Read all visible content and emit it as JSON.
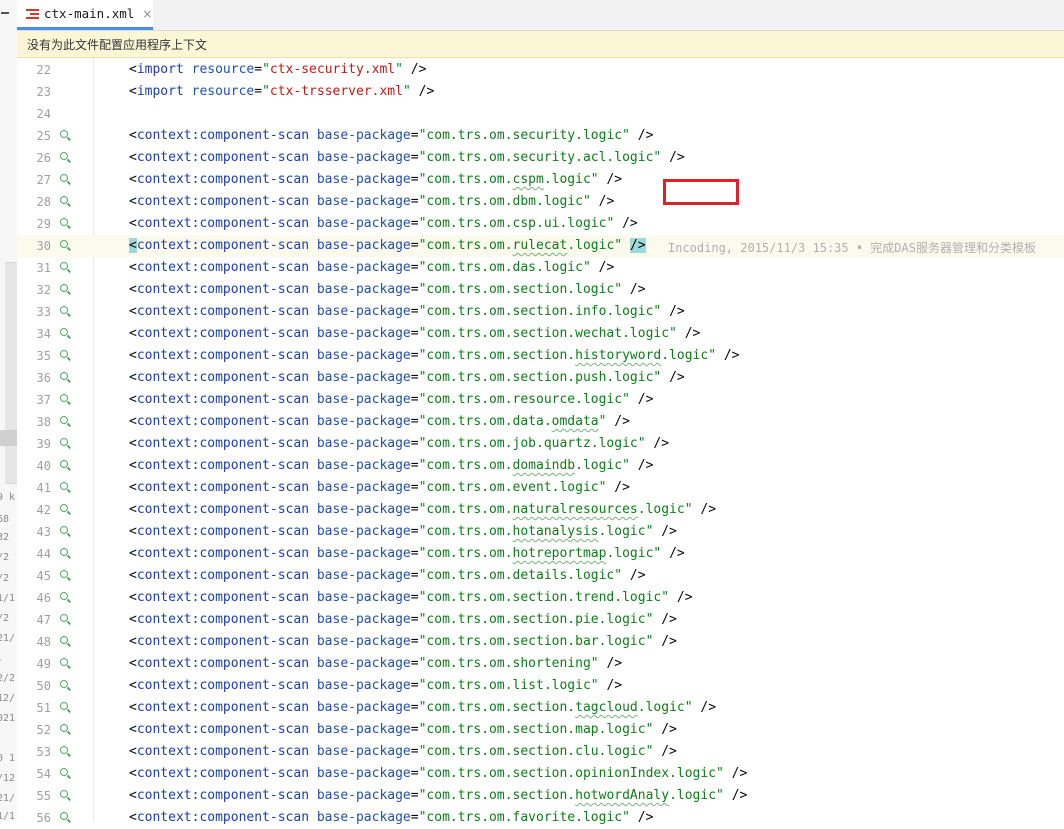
{
  "left_panel": {
    "fragments": [
      "9 k",
      "68",
      "32",
      "/2",
      "/2",
      "1/1",
      "/2",
      "21/",
      "-",
      "2/2",
      "12/",
      "021",
      "0 1",
      "/12",
      "21/",
      "1/1"
    ]
  },
  "tab": {
    "label": "ctx-main.xml",
    "close": "×"
  },
  "banner": {
    "text": "没有为此文件配置应用程序上下文"
  },
  "editor": {
    "current_line": 30,
    "blame": "Incoding, 2015/11/3 15:35 • 完成DAS服务器管理和分类模板",
    "lines": [
      {
        "num": "22",
        "kind": "import",
        "tag": "import",
        "attr": "resource",
        "value": "ctx-security.xml"
      },
      {
        "num": "23",
        "kind": "import",
        "tag": "import",
        "attr": "resource",
        "value": "ctx-trsserver.xml"
      },
      {
        "num": "24",
        "kind": "blank"
      },
      {
        "num": "25",
        "kind": "scan",
        "pre": "com.trs.om.security",
        "ul": "",
        "post": ".logic"
      },
      {
        "num": "26",
        "kind": "scan",
        "pre": "com.trs.om.security.acl.logic",
        "ul": "",
        "post": ""
      },
      {
        "num": "27",
        "kind": "scan",
        "pre": "com.trs.om.",
        "ul": "cspm",
        "post": ".logic"
      },
      {
        "num": "28",
        "kind": "scan",
        "pre": "com.trs.om.dbm.logic",
        "ul": "",
        "post": ""
      },
      {
        "num": "29",
        "kind": "scan",
        "pre": "com.trs.om.csp.ui.logic",
        "ul": "",
        "post": ""
      },
      {
        "num": "30",
        "kind": "scan",
        "pre": "com.trs.om.",
        "ul": "rulecat",
        "post": ".logic"
      },
      {
        "num": "31",
        "kind": "scan",
        "pre": "com.trs.om.das.logic",
        "ul": "",
        "post": ""
      },
      {
        "num": "32",
        "kind": "scan",
        "pre": "com.trs.om.section.logic",
        "ul": "",
        "post": ""
      },
      {
        "num": "33",
        "kind": "scan",
        "pre": "com.trs.om.section.info.logic",
        "ul": "",
        "post": ""
      },
      {
        "num": "34",
        "kind": "scan",
        "pre": "com.trs.om.section.wechat.logic",
        "ul": "",
        "post": ""
      },
      {
        "num": "35",
        "kind": "scan",
        "pre": "com.trs.om.section.",
        "ul": "historyword",
        "post": ".logic"
      },
      {
        "num": "36",
        "kind": "scan",
        "pre": "com.trs.om.section.push.logic",
        "ul": "",
        "post": ""
      },
      {
        "num": "37",
        "kind": "scan",
        "pre": "com.trs.om.resource.logic",
        "ul": "",
        "post": ""
      },
      {
        "num": "38",
        "kind": "scan",
        "pre": "com.trs.om.data.",
        "ul": "omdata",
        "post": ""
      },
      {
        "num": "39",
        "kind": "scan",
        "pre": "com.trs.om.job.quartz.logic",
        "ul": "",
        "post": ""
      },
      {
        "num": "40",
        "kind": "scan",
        "pre": "com.trs.om.",
        "ul": "domaindb",
        "post": ".logic"
      },
      {
        "num": "41",
        "kind": "scan",
        "pre": "com.trs.om.event.logic",
        "ul": "",
        "post": ""
      },
      {
        "num": "42",
        "kind": "scan",
        "pre": "com.trs.om.",
        "ul": "naturalresources",
        "post": ".logic"
      },
      {
        "num": "43",
        "kind": "scan",
        "pre": "com.trs.om.",
        "ul": "hotanalysis",
        "post": ".logic"
      },
      {
        "num": "44",
        "kind": "scan",
        "pre": "com.trs.om.",
        "ul": "hotreportmap",
        "post": ".logic"
      },
      {
        "num": "45",
        "kind": "scan",
        "pre": "com.trs.om.details.logic",
        "ul": "",
        "post": ""
      },
      {
        "num": "46",
        "kind": "scan",
        "pre": "com.trs.om.section.trend.logic",
        "ul": "",
        "post": ""
      },
      {
        "num": "47",
        "kind": "scan",
        "pre": "com.trs.om.section.pie.logic",
        "ul": "",
        "post": ""
      },
      {
        "num": "48",
        "kind": "scan",
        "pre": "com.trs.om.section.bar.logic",
        "ul": "",
        "post": ""
      },
      {
        "num": "49",
        "kind": "scan",
        "pre": "com.trs.om.shortening",
        "ul": "",
        "post": ""
      },
      {
        "num": "50",
        "kind": "scan",
        "pre": "com.trs.om.list.logic",
        "ul": "",
        "post": ""
      },
      {
        "num": "51",
        "kind": "scan",
        "pre": "com.trs.om.section.",
        "ul": "tagcloud",
        "post": ".logic"
      },
      {
        "num": "52",
        "kind": "scan",
        "pre": "com.trs.om.section.map.logic",
        "ul": "",
        "post": ""
      },
      {
        "num": "53",
        "kind": "scan",
        "pre": "com.trs.om.section.clu.logic",
        "ul": "",
        "post": ""
      },
      {
        "num": "54",
        "kind": "scan",
        "pre": "com.trs.om.section.opinionIndex.logic",
        "ul": "",
        "post": ""
      },
      {
        "num": "55",
        "kind": "scan",
        "pre": "com.trs.om.section.",
        "ul": "hotwordAnaly",
        "post": ".logic"
      },
      {
        "num": "56",
        "kind": "scan",
        "pre": "com.trs.om.favorite.logic",
        "ul": "",
        "post": ""
      }
    ],
    "scan_tag": "context:component-scan",
    "scan_attr": "base-package"
  },
  "colors": {
    "highlight_box": "#e0202a",
    "tab_accent": "#4a8ee8",
    "banner_bg": "#fbf7d6"
  }
}
